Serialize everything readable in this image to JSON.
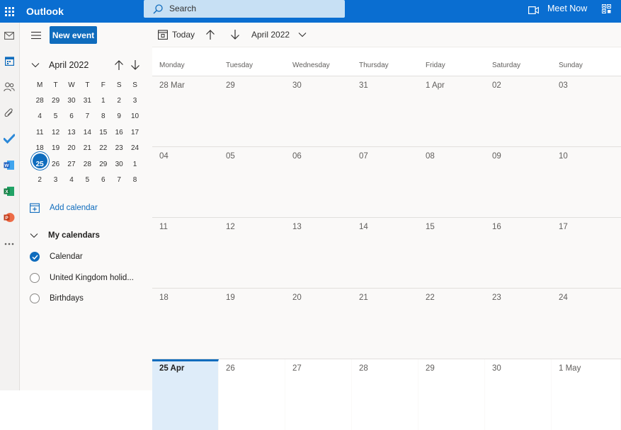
{
  "topbar": {
    "app_name": "Outlook",
    "search_placeholder": "Search",
    "meet_now": "Meet Now",
    "color": "#0f6cbd"
  },
  "rail": {
    "icons": [
      "mail-icon",
      "calendar-icon",
      "people-icon",
      "attach-icon",
      "todo-icon",
      "word-icon",
      "excel-icon",
      "powerpoint-icon",
      "more-apps-icon"
    ]
  },
  "side": {
    "new_event": "New event",
    "mini_month": "April 2022",
    "weekday_letters": [
      "M",
      "T",
      "W",
      "T",
      "F",
      "S",
      "S"
    ],
    "weeks": [
      [
        "28",
        "29",
        "30",
        "31",
        "1",
        "2",
        "3"
      ],
      [
        "4",
        "5",
        "6",
        "7",
        "8",
        "9",
        "10"
      ],
      [
        "11",
        "12",
        "13",
        "14",
        "15",
        "16",
        "17"
      ],
      [
        "18",
        "19",
        "20",
        "21",
        "22",
        "23",
        "24"
      ],
      [
        "25",
        "26",
        "27",
        "28",
        "29",
        "30",
        "1"
      ],
      [
        "2",
        "3",
        "4",
        "5",
        "6",
        "7",
        "8"
      ]
    ],
    "today": "25",
    "add_calendar": "Add calendar",
    "my_calendars": "My calendars",
    "calendars": [
      {
        "name": "Calendar",
        "checked": true
      },
      {
        "name": "United Kingdom holid...",
        "checked": false
      },
      {
        "name": "Birthdays",
        "checked": false
      }
    ]
  },
  "toolbar": {
    "today": "Today",
    "month": "April 2022"
  },
  "month_view": {
    "day_names": [
      "Monday",
      "Tuesday",
      "Wednesday",
      "Thursday",
      "Friday",
      "Saturday",
      "Sunday"
    ],
    "weeks": [
      [
        "28 Mar",
        "29",
        "30",
        "31",
        "1 Apr",
        "02",
        "03"
      ],
      [
        "04",
        "05",
        "06",
        "07",
        "08",
        "09",
        "10"
      ],
      [
        "11",
        "12",
        "13",
        "14",
        "15",
        "16",
        "17"
      ],
      [
        "18",
        "19",
        "20",
        "21",
        "22",
        "23",
        "24"
      ],
      [
        "25 Apr",
        "26",
        "27",
        "28",
        "29",
        "30",
        "1 May"
      ]
    ],
    "today_label": "25 Apr"
  }
}
